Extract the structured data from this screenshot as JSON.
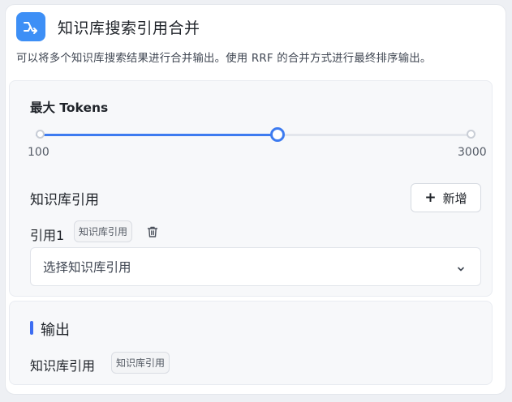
{
  "node": {
    "title": "知识库搜索引用合并",
    "icon": "merge-arrow-icon",
    "icon_color": "#3d8ff6",
    "description": "可以将多个知识库搜索结果进行合并输出。使用 RRF 的合并方式进行最终排序输出。"
  },
  "max_tokens": {
    "label": "最大 Tokens",
    "min_label": "100",
    "max_label": "3000",
    "level_fraction": 0.55,
    "accent": "#3d7bf0"
  },
  "kb_refs": {
    "title": "知识库引用",
    "add_button": "新增",
    "items": [
      {
        "label": "引用1",
        "tag": "知识库引用",
        "select_placeholder": "选择知识库引用"
      }
    ]
  },
  "output": {
    "title": "输出",
    "items": [
      {
        "label": "知识库引用",
        "tag": "知识库引用"
      }
    ]
  }
}
